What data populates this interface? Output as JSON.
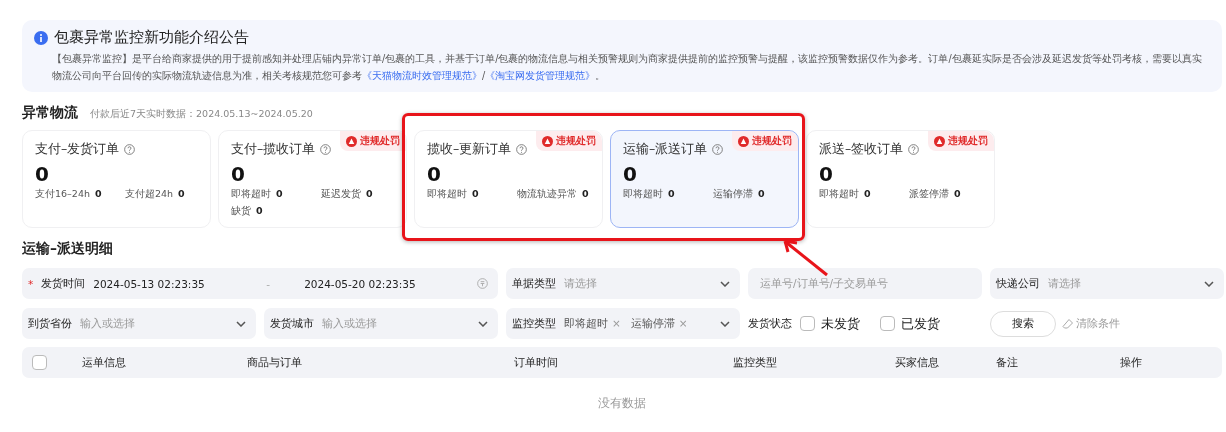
{
  "notice": {
    "title": "包裹异常监控新功能介绍公告",
    "body": "【包裹异常监控】是平台给商家提供的用于提前感知并处理店铺内异常订单/包裹的工具，并基于订单/包裹的物流信息与相关预警规则为商家提供提前的监控预警与提醒，该监控预警数据仅作为参考。订单/包裹延实际是否会涉及延迟发货等处罚考核，需要以真实物流公司向平台回传的实际物流轨迹信息为准，相关考核规范您可参考",
    "links": [
      "《天猫物流时效管理规范》",
      "《淘宝网发货管理规范》"
    ],
    "separator": "/",
    "end": "。"
  },
  "overview": {
    "title": "异常物流",
    "subtitle": "付款后近7天实时数据：2024.05.13~2024.05.20",
    "cards": [
      {
        "title": "支付–发货订单",
        "value": "0",
        "selected": false,
        "stats": [
          {
            "label": "支付16–24h",
            "value": "0"
          },
          {
            "label": "支付超24h",
            "value": "0"
          }
        ]
      },
      {
        "title": "支付–揽收订单",
        "value": "0",
        "selected": false,
        "badge": "违规处罚",
        "stats": [
          {
            "label": "即将超时",
            "value": "0"
          },
          {
            "label": "延迟发货",
            "value": "0"
          },
          {
            "label": "缺货",
            "value": "0"
          }
        ]
      },
      {
        "title": "揽收–更新订单",
        "value": "0",
        "selected": false,
        "badge": "违规处罚",
        "stats": [
          {
            "label": "即将超时",
            "value": "0"
          },
          {
            "label": "物流轨迹异常",
            "value": "0"
          }
        ]
      },
      {
        "title": "运输–派送订单",
        "value": "0",
        "selected": true,
        "badge": "违规处罚",
        "stats": [
          {
            "label": "即将超时",
            "value": "0"
          },
          {
            "label": "运输停滞",
            "value": "0"
          }
        ]
      },
      {
        "title": "派送–签收订单",
        "value": "0",
        "selected": false,
        "badge": "违规处罚",
        "stats": [
          {
            "label": "即将超时",
            "value": "0"
          },
          {
            "label": "派签停滞",
            "value": "0"
          }
        ]
      }
    ]
  },
  "detail": {
    "title": "运输–派送明细",
    "filters": [
      {
        "kind": "daterange",
        "label": "发货时间",
        "required_mark": "*",
        "start": "2024-05-13 02:23:35",
        "dash": "-",
        "end": "2024-05-20 02:23:35"
      },
      {
        "kind": "select",
        "label": "单据类型",
        "placeholder": "请选择"
      },
      {
        "kind": "input",
        "placeholder": "运单号/订单号/子交易单号"
      },
      {
        "kind": "select",
        "label": "快递公司",
        "placeholder": "请选择"
      },
      {
        "kind": "select",
        "label": "到货省份",
        "placeholder": "输入或选择"
      },
      {
        "kind": "select",
        "label": "发货城市",
        "placeholder": "输入或选择"
      },
      {
        "kind": "tags",
        "label": "监控类型",
        "tags": [
          {
            "text": "即将超时",
            "remove": "×"
          },
          {
            "text": "运输停滞",
            "remove": "×"
          }
        ]
      },
      {
        "kind": "checks",
        "label": "发货状态",
        "options": [
          {
            "label": "未发货",
            "checked": false
          },
          {
            "label": "已发货",
            "checked": false
          }
        ]
      },
      {
        "kind": "actions",
        "button": "搜索",
        "clear": "清除条件"
      }
    ],
    "table": {
      "select_all": false,
      "columns": [
        "运单信息",
        "商品与订单",
        "订单时间",
        "监控类型",
        "买家信息",
        "备注",
        "操作"
      ],
      "empty": "没有数据"
    }
  }
}
